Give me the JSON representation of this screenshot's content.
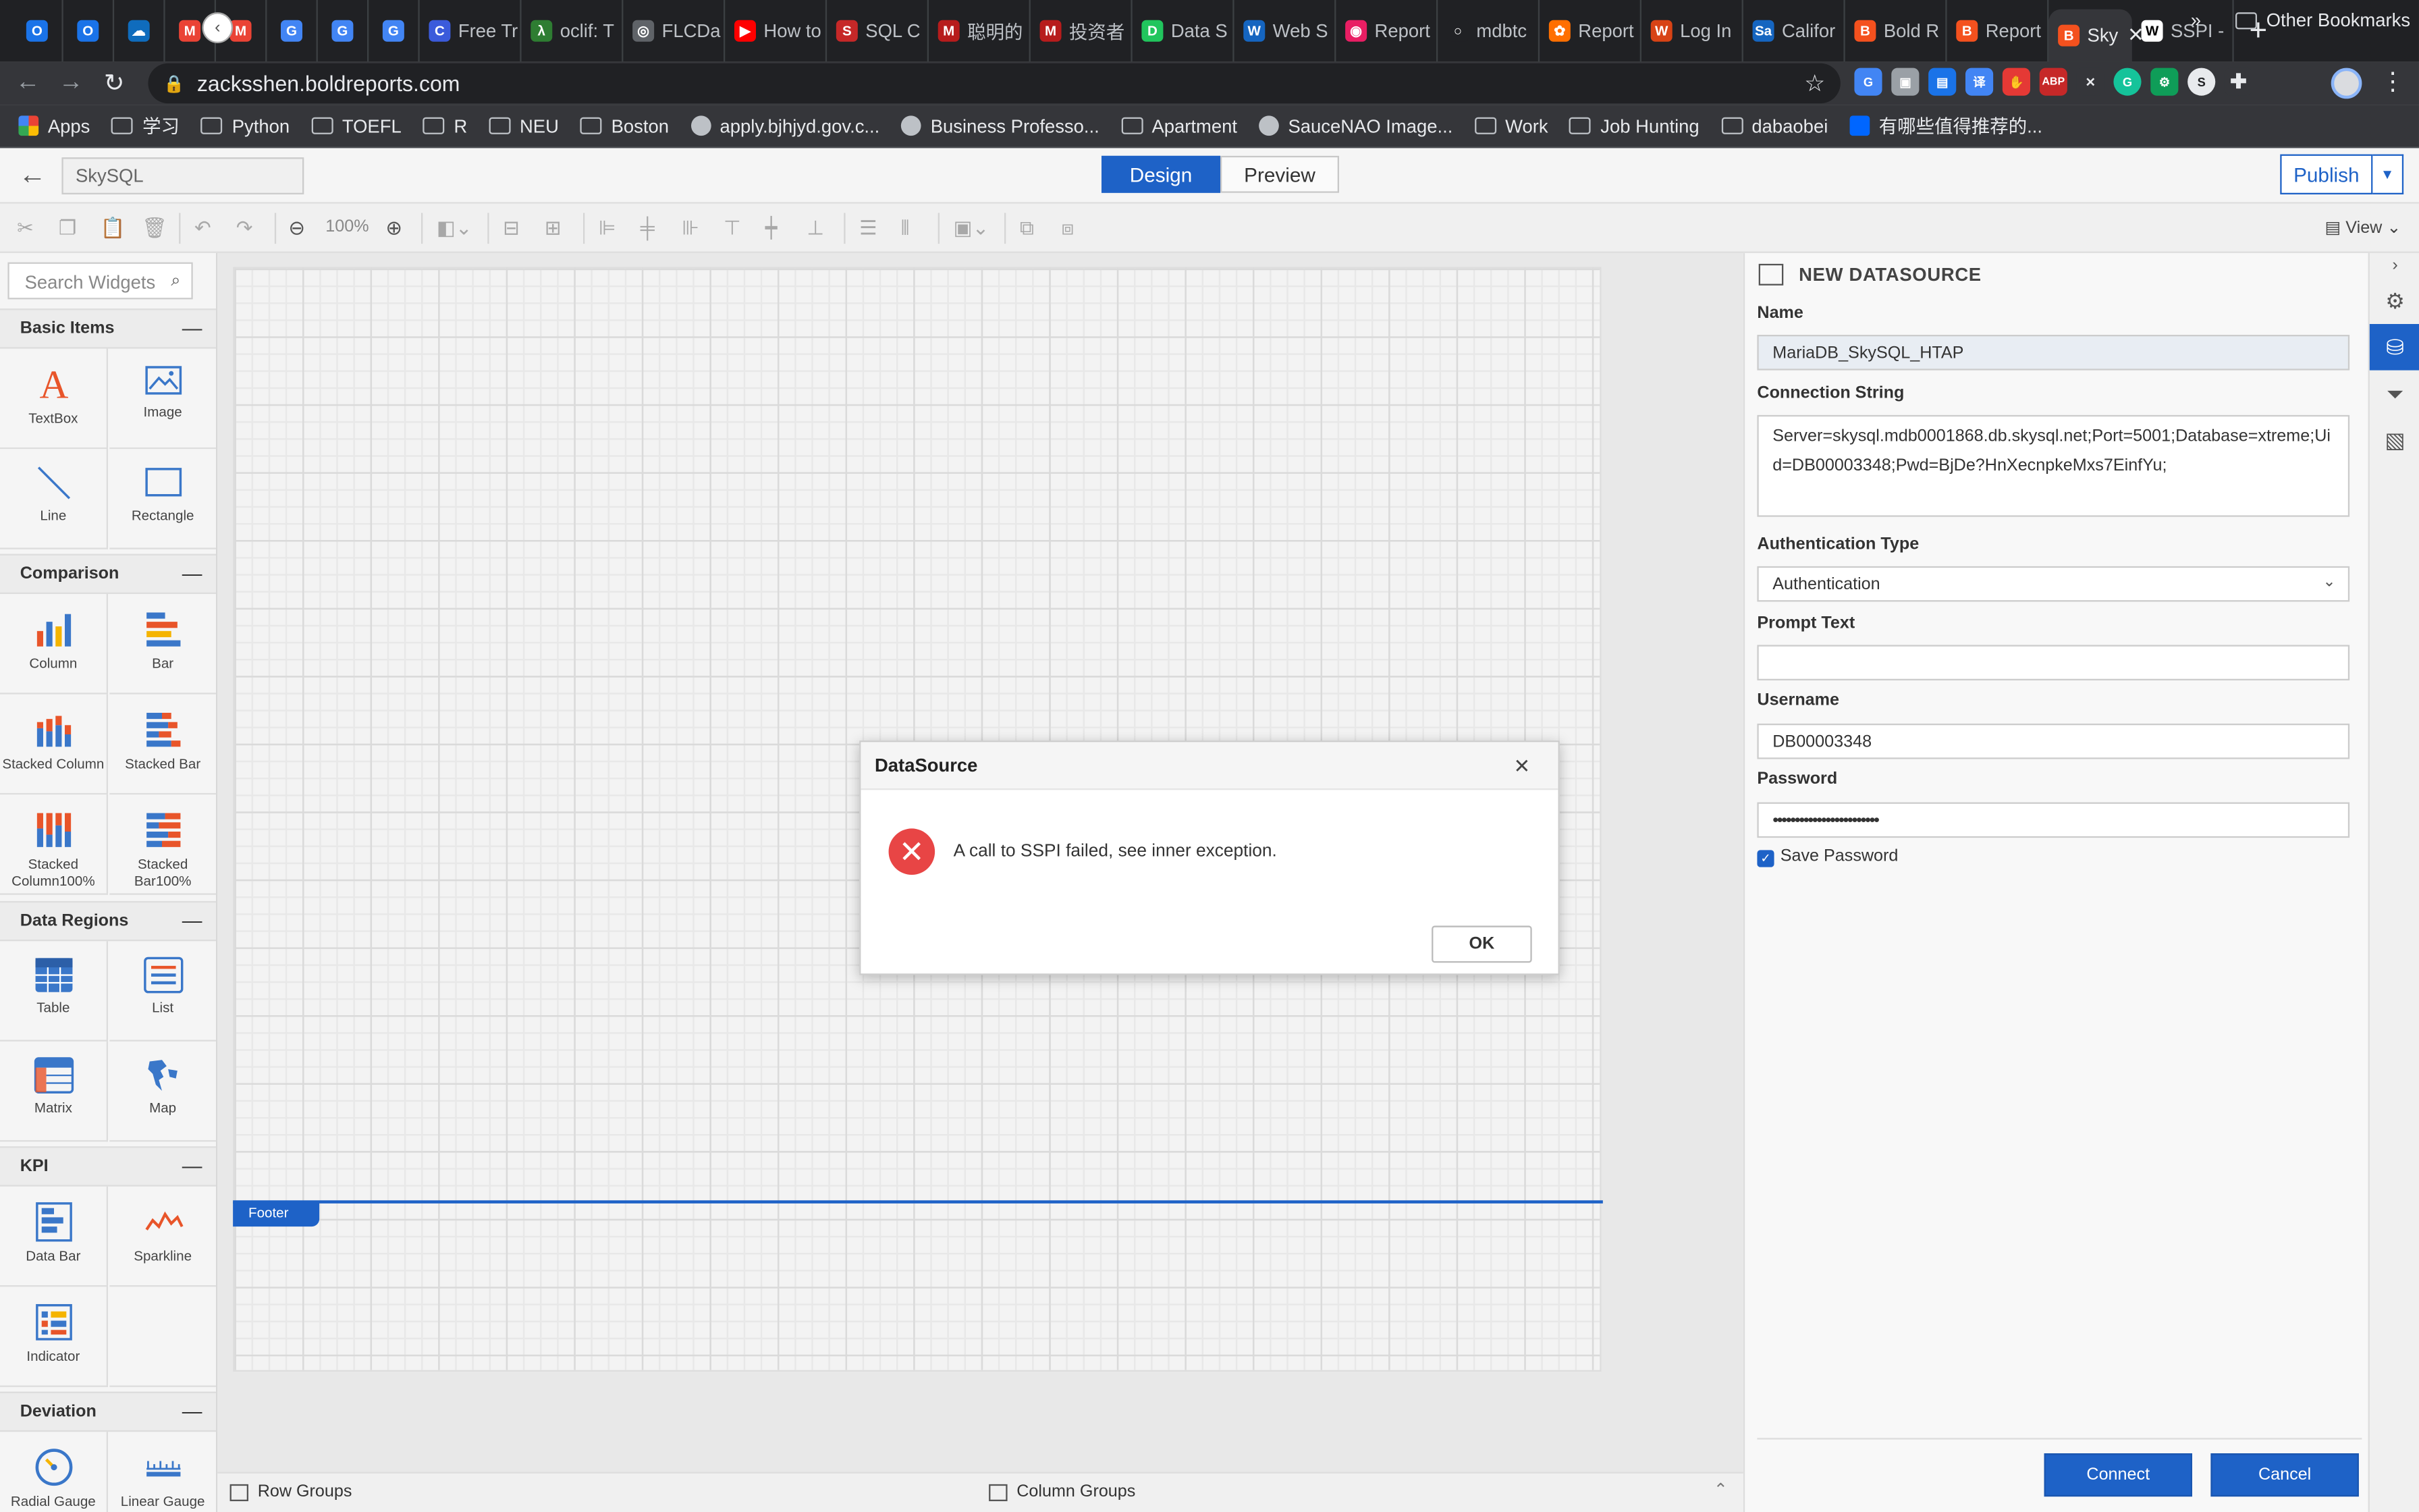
{
  "browser": {
    "tabs": [
      {
        "label": "",
        "color": "#1a73e8",
        "glyph": "O"
      },
      {
        "label": "",
        "color": "#1a73e8",
        "glyph": "O"
      },
      {
        "label": "",
        "color": "#0f6cbd",
        "glyph": "☁"
      },
      {
        "label": "",
        "color": "#ea4335",
        "glyph": "M"
      },
      {
        "label": "",
        "color": "#ea4335",
        "glyph": "M"
      },
      {
        "label": "",
        "color": "#4285f4",
        "glyph": "G"
      },
      {
        "label": "",
        "color": "#4285f4",
        "glyph": "G"
      },
      {
        "label": "",
        "color": "#4285f4",
        "glyph": "G"
      },
      {
        "label": "Free Tr",
        "color": "#3b5bdb",
        "glyph": "C"
      },
      {
        "label": "oclif: T",
        "color": "#2e7d32",
        "glyph": "λ"
      },
      {
        "label": "FLCDa",
        "color": "#5f6368",
        "glyph": "◎"
      },
      {
        "label": "How to",
        "color": "#ff0000",
        "glyph": "▶"
      },
      {
        "label": "SQL C",
        "color": "#c62828",
        "glyph": "S"
      },
      {
        "label": "聪明的",
        "color": "#b71c1c",
        "glyph": "M"
      },
      {
        "label": "投资者",
        "color": "#b71c1c",
        "glyph": "M"
      },
      {
        "label": "Data S",
        "color": "#21c55d",
        "glyph": "D"
      },
      {
        "label": "Web S",
        "color": "#1565c0",
        "glyph": "W"
      },
      {
        "label": "Report",
        "color": "#e91e63",
        "glyph": "◉"
      },
      {
        "label": "mdbtc",
        "color": "#202124",
        "glyph": "○"
      },
      {
        "label": "Report",
        "color": "#ff6f00",
        "glyph": "✿"
      },
      {
        "label": "Log In",
        "color": "#d84315",
        "glyph": "W"
      },
      {
        "label": "Califor",
        "color": "#1565c0",
        "glyph": "Sa"
      },
      {
        "label": "Bold R",
        "color": "#f4511e",
        "glyph": "B"
      },
      {
        "label": "Report",
        "color": "#f4511e",
        "glyph": "B"
      },
      {
        "label": "Sky",
        "color": "#f4511e",
        "glyph": "B",
        "active": true
      },
      {
        "label": "SSPI -",
        "color": "#ffffff",
        "glyph": "W"
      }
    ],
    "url": "zacksshen.boldreports.com",
    "bookmarks": [
      {
        "label": "Apps",
        "type": "apps"
      },
      {
        "label": "学习",
        "type": "folder"
      },
      {
        "label": "Python",
        "type": "folder"
      },
      {
        "label": "TOEFL",
        "type": "folder"
      },
      {
        "label": "R",
        "type": "folder"
      },
      {
        "label": "NEU",
        "type": "folder"
      },
      {
        "label": "Boston",
        "type": "folder"
      },
      {
        "label": "apply.bjhjyd.gov.c...",
        "type": "globe"
      },
      {
        "label": "Business Professo...",
        "type": "site"
      },
      {
        "label": "Apartment",
        "type": "folder"
      },
      {
        "label": "SauceNAO Image...",
        "type": "site"
      },
      {
        "label": "Work",
        "type": "folder"
      },
      {
        "label": "Job Hunting",
        "type": "folder"
      },
      {
        "label": "dabaobei",
        "type": "folder"
      },
      {
        "label": "有哪些值得推荐的...",
        "type": "zhihu"
      }
    ],
    "bookmarks_more": "»",
    "other_bookmarks": "Other Bookmarks"
  },
  "header": {
    "report_name": "SkySQL",
    "design_label": "Design",
    "preview_label": "Preview",
    "publish_label": "Publish"
  },
  "toolbar": {
    "zoom": "100%",
    "view_label": "View"
  },
  "widgets": {
    "search_placeholder": "Search Widgets",
    "sections": {
      "basic": "Basic Items",
      "comparison": "Comparison",
      "data_regions": "Data Regions",
      "kpi": "KPI",
      "deviation": "Deviation"
    },
    "items": {
      "textbox": "TextBox",
      "image": "Image",
      "line": "Line",
      "rectangle": "Rectangle",
      "column": "Column",
      "bar": "Bar",
      "stacked_column": "Stacked Column",
      "stacked_bar": "Stacked Bar",
      "stacked_column100": "Stacked Column100%",
      "stacked_bar100": "Stacked Bar100%",
      "table": "Table",
      "list": "List",
      "matrix": "Matrix",
      "map": "Map",
      "data_bar": "Data Bar",
      "sparkline": "Sparkline",
      "indicator": "Indicator",
      "radial_gauge": "Radial Gauge",
      "linear_gauge": "Linear Gauge"
    }
  },
  "canvas": {
    "footer_label": "Footer"
  },
  "groups": {
    "row_groups": "Row Groups",
    "column_groups": "Column Groups"
  },
  "datasource": {
    "title": "NEW DATASOURCE",
    "name_label": "Name",
    "name_value": "MariaDB_SkySQL_HTAP",
    "connection_label": "Connection String",
    "connection_value": "Server=skysql.mdb0001868.db.skysql.net;Port=5001;Database=xtreme;Uid=DB00003348;Pwd=BjDe?HnXecnpkeMxs7EinfYu;",
    "auth_type_label": "Authentication Type",
    "auth_type_value": "Authentication",
    "prompt_label": "Prompt Text",
    "prompt_value": "",
    "username_label": "Username",
    "username_value": "DB00003348",
    "password_label": "Password",
    "password_value": "••••••••••••••••••••••••",
    "save_password_label": "Save Password",
    "connect_label": "Connect",
    "cancel_label": "Cancel"
  },
  "dialog": {
    "title": "DataSource",
    "message": "A call to SSPI failed, see inner exception.",
    "ok_label": "OK"
  }
}
